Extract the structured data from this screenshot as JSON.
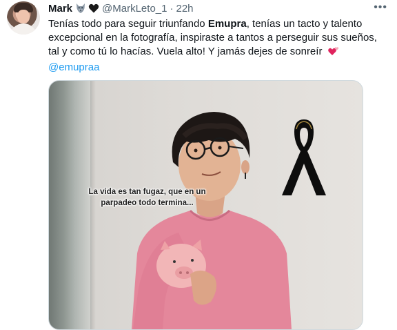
{
  "tweet": {
    "display_name": "Mark",
    "handle": "@MarkLeto_1",
    "separator": "·",
    "time": "22h",
    "more_icon": "more-dots-icon",
    "text_part1": "Tenías todo para seguir triunfando ",
    "text_bold": "Emupra",
    "text_part2": ", tenías un tacto y talento excepcional en la fotografía, inspiraste a tantos a perseguir sus sueños, tal y como tú lo hacías. Vuela alto! Y jamás dejes de sonreír ",
    "mention": "@emupraa",
    "name_badges": [
      "wolf-emoji-icon",
      "black-heart-emoji-icon"
    ],
    "text_emoji": "revolving-hearts-emoji-icon"
  },
  "media": {
    "overlay_text": "La vida es tan fugaz, que en un parpadeo todo termina..."
  },
  "colors": {
    "link": "#1d9bf0",
    "secondary_text": "#536471",
    "shirt": "#e6869b"
  }
}
